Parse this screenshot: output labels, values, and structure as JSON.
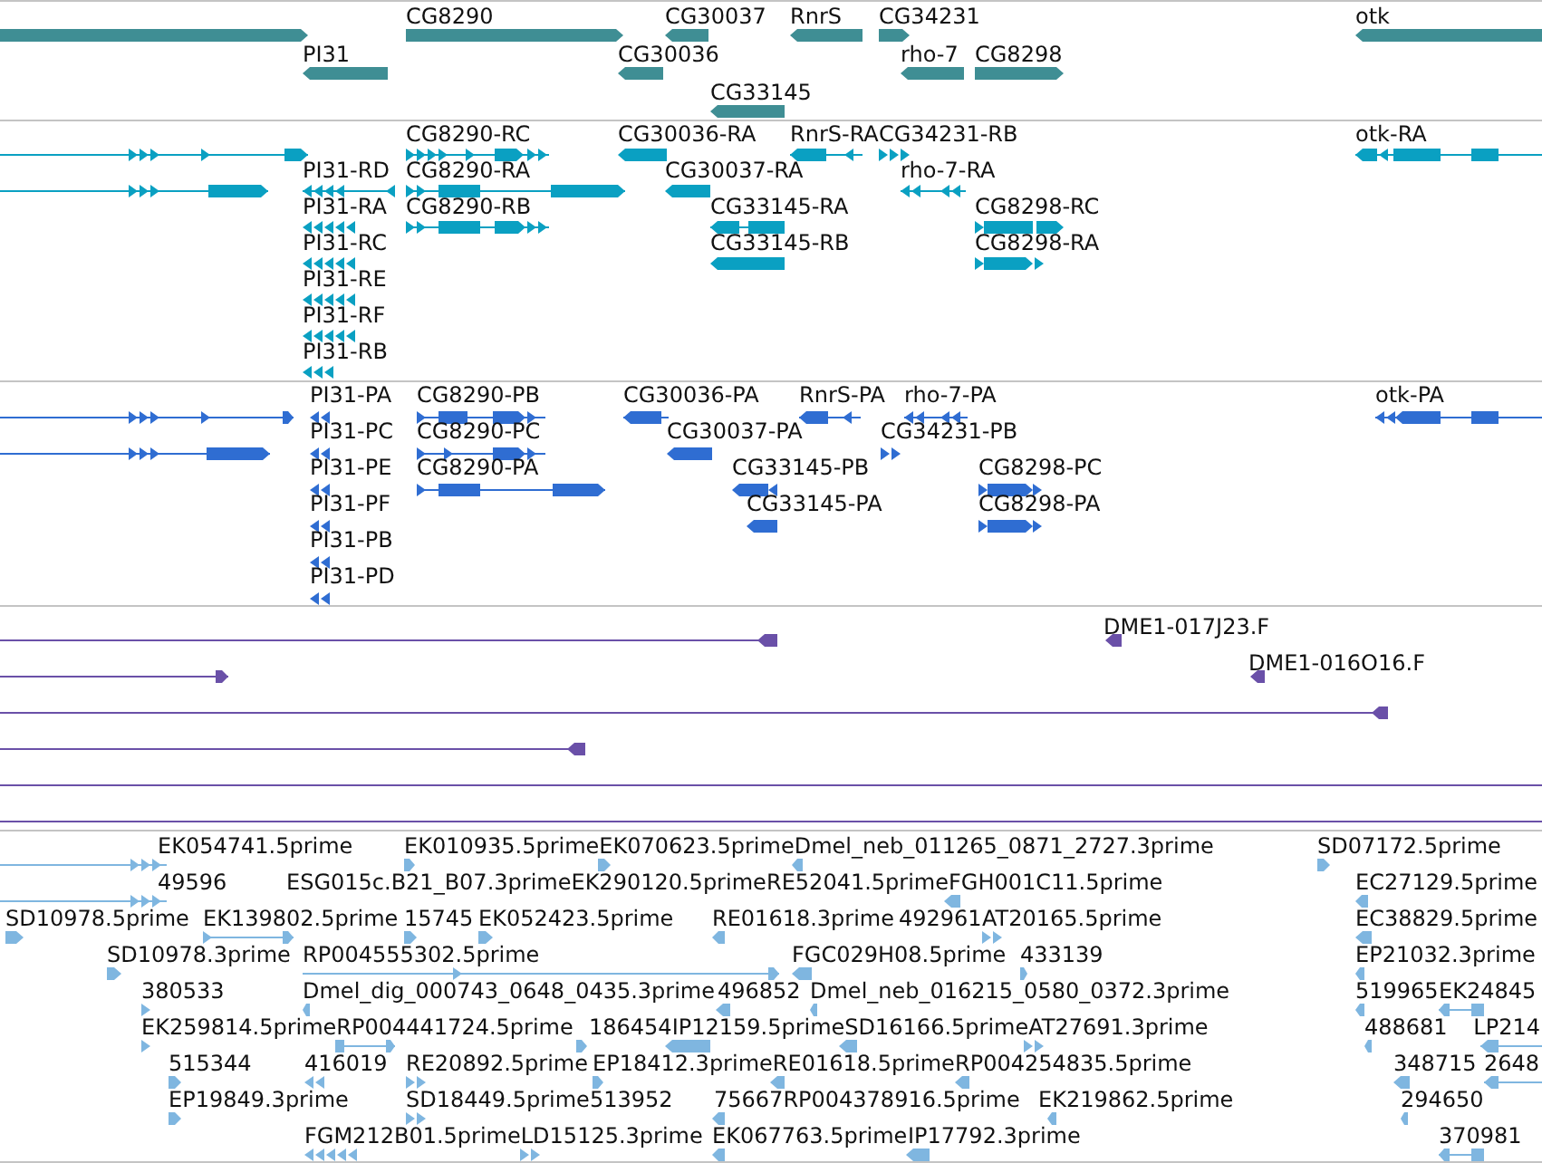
{
  "tracks": [
    {
      "kind": "gene",
      "features": [
        {
          "reverse": false,
          "selected": false
        },
        {
          "label": "CG8290",
          "reverse": false,
          "selected": false
        },
        {
          "label": "CG30037",
          "reverse": true,
          "selected": false
        },
        {
          "label": "RnrS",
          "reverse": true,
          "selected": false
        },
        {
          "label": "CG34231",
          "reverse": false,
          "selected": false
        },
        {
          "label": "otk",
          "reverse": true,
          "selected": false
        },
        {
          "label": "PI31",
          "reverse": true,
          "selected": false
        },
        {
          "label": "CG30036",
          "reverse": true,
          "selected": false
        },
        {
          "label": "rho-7",
          "reverse": true,
          "selected": false
        },
        {
          "label": "CG8298",
          "reverse": false,
          "selected": false
        },
        {
          "label": "CG33145",
          "reverse": true,
          "selected": false
        }
      ]
    },
    {
      "kind": "transcript",
      "features": [
        {
          "reverse": false,
          "selected": false
        },
        {
          "label": "CG8290-RC",
          "reverse": false,
          "selected": false
        },
        {
          "label": "CG30036-RA",
          "reverse": true,
          "selected": false
        },
        {
          "label": "RnrS-RA",
          "reverse": true,
          "selected": false
        },
        {
          "label": "CG34231-RB",
          "reverse": false,
          "selected": false
        },
        {
          "label": "otk-RA",
          "reverse": true,
          "selected": false
        },
        {
          "reverse": false,
          "selected": false
        },
        {
          "label": "PI31-RD",
          "reverse": true,
          "selected": false
        },
        {
          "label": "CG8290-RA",
          "reverse": false,
          "selected": false
        },
        {
          "label": "CG30037-RA",
          "reverse": true,
          "selected": false
        },
        {
          "label": "rho-7-RA",
          "reverse": true,
          "selected": false
        },
        {
          "label": "PI31-RA",
          "reverse": true,
          "selected": false
        },
        {
          "label": "CG8290-RB",
          "reverse": false,
          "selected": false
        },
        {
          "label": "CG33145-RA",
          "reverse": true,
          "selected": false
        },
        {
          "label": "CG8298-RC",
          "reverse": false,
          "selected": false
        },
        {
          "label": "PI31-RC",
          "reverse": true,
          "selected": false
        },
        {
          "label": "CG33145-RB",
          "reverse": true,
          "selected": false
        },
        {
          "label": "CG8298-RA",
          "reverse": false,
          "selected": false
        },
        {
          "label": "PI31-RE",
          "reverse": true,
          "selected": false
        },
        {
          "label": "PI31-RF",
          "reverse": true,
          "selected": false
        },
        {
          "label": "PI31-RB",
          "reverse": true,
          "selected": false
        }
      ]
    },
    {
      "kind": "protein",
      "features": [
        {
          "reverse": false,
          "selected": false
        },
        {
          "label": "PI31-PA",
          "reverse": true,
          "selected": false
        },
        {
          "label": "CG8290-PB",
          "reverse": false,
          "selected": false
        },
        {
          "label": "CG30036-PA",
          "reverse": true,
          "selected": false
        },
        {
          "label": "RnrS-PA",
          "reverse": true,
          "selected": false
        },
        {
          "label": "rho-7-PA",
          "reverse": true,
          "selected": false
        },
        {
          "label": "otk-PA",
          "reverse": true,
          "selected": false
        },
        {
          "reverse": false,
          "selected": false
        },
        {
          "label": "PI31-PC",
          "reverse": true,
          "selected": false
        },
        {
          "label": "CG8290-PC",
          "reverse": false,
          "selected": false
        },
        {
          "label": "CG30037-PA",
          "reverse": true,
          "selected": false
        },
        {
          "label": "CG34231-PB",
          "reverse": false,
          "selected": false
        },
        {
          "label": "PI31-PE",
          "reverse": true,
          "selected": false
        },
        {
          "label": "CG8290-PA",
          "reverse": false,
          "selected": false
        },
        {
          "label": "CG33145-PB",
          "reverse": true,
          "selected": false
        },
        {
          "label": "CG8298-PC",
          "reverse": false,
          "selected": false
        },
        {
          "label": "PI31-PF",
          "reverse": true,
          "selected": false
        },
        {
          "label": "CG33145-PA",
          "reverse": true,
          "selected": false
        },
        {
          "label": "CG8298-PA",
          "reverse": false,
          "selected": false
        },
        {
          "label": "PI31-PB",
          "reverse": true,
          "selected": false
        },
        {
          "label": "PI31-PD",
          "reverse": true,
          "selected": false
        }
      ]
    },
    {
      "kind": "clone",
      "features": [
        {
          "reverse": true,
          "selected": false
        },
        {
          "label": "DME1-017J23.F",
          "reverse": true,
          "selected": false
        },
        {
          "reverse": false,
          "selected": false
        },
        {
          "label": "DME1-016O16.F",
          "reverse": true,
          "selected": false
        },
        {
          "reverse": true,
          "selected": false
        },
        {
          "reverse": true,
          "selected": false
        },
        {
          "selected": false
        },
        {
          "selected": false
        }
      ]
    },
    {
      "kind": "est",
      "features": [
        {
          "label": "EK054741.5prime",
          "reverse": false,
          "selected": false
        },
        {
          "label": "EK010935.5prime",
          "reverse": false,
          "selected": false
        },
        {
          "label": "EK070623.5prime",
          "reverse": false,
          "selected": false
        },
        {
          "label": "Dmel_neb_011265_0871_2727.3prime",
          "reverse": true,
          "selected": false
        },
        {
          "label": "SD07172.5prime",
          "reverse": false,
          "selected": false
        },
        {
          "label": "49596",
          "reverse": false,
          "selected": false
        },
        {
          "label": "ESG015c.B21_B07.3prime",
          "selected": false
        },
        {
          "label": "EK290120.5prime",
          "selected": false
        },
        {
          "label": "RE52041.5prime",
          "selected": false
        },
        {
          "label": "FGH001C11.5prime",
          "reverse": true,
          "selected": false
        },
        {
          "label": "EC27129.5prime",
          "reverse": true,
          "selected": false
        },
        {
          "label": "SD10978.5prime",
          "reverse": false,
          "selected": false
        },
        {
          "label": "EK139802.5prime",
          "reverse": false,
          "selected": false
        },
        {
          "label": "15745",
          "reverse": false,
          "selected": false
        },
        {
          "label": "EK052423.5prime",
          "reverse": false,
          "selected": false
        },
        {
          "label": "RE01618.3prime",
          "reverse": true,
          "selected": false
        },
        {
          "label": "492961",
          "selected": false
        },
        {
          "label": "AT20165.5prime",
          "reverse": false,
          "selected": false
        },
        {
          "label": "EC38829.5prime",
          "reverse": true,
          "selected": false
        },
        {
          "label": "SD10978.3prime",
          "reverse": false,
          "selected": false
        },
        {
          "label": "RP004555302.5prime",
          "reverse": false,
          "selected": false
        },
        {
          "label": "FGC029H08.5prime",
          "reverse": true,
          "selected": false
        },
        {
          "label": "433139",
          "reverse": false,
          "selected": false
        },
        {
          "label": "EP21032.3prime",
          "reverse": true,
          "selected": false
        },
        {
          "label": "380533",
          "reverse": false,
          "selected": false
        },
        {
          "label": "Dmel_dig_000743_0648_0435.3prime",
          "reverse": true,
          "selected": false
        },
        {
          "label": "496852",
          "reverse": true,
          "selected": false
        },
        {
          "label": "Dmel_neb_016215_0580_0372.3prime",
          "reverse": true,
          "selected": false
        },
        {
          "label": "519965",
          "reverse": true,
          "selected": false
        },
        {
          "label": "EK24845",
          "reverse": true,
          "selected": false
        },
        {
          "label": "EK259814.5prime",
          "reverse": false,
          "selected": false
        },
        {
          "label": "RP004441724.5prime",
          "reverse": false,
          "selected": false
        },
        {
          "label": "186454",
          "reverse": false,
          "selected": false
        },
        {
          "label": "IP12159.5prime",
          "reverse": true,
          "selected": false
        },
        {
          "label": "SD16166.5prime",
          "reverse": true,
          "selected": false
        },
        {
          "label": "AT27691.3prime",
          "reverse": false,
          "selected": false
        },
        {
          "label": "488681",
          "reverse": true,
          "selected": false
        },
        {
          "label": "LP214",
          "reverse": true,
          "selected": false
        },
        {
          "label": "515344",
          "reverse": false,
          "selected": false
        },
        {
          "label": "416019",
          "reverse": true,
          "selected": false
        },
        {
          "label": "RE20892.5prime",
          "reverse": false,
          "selected": false
        },
        {
          "label": "EP18412.3prime",
          "reverse": false,
          "selected": false
        },
        {
          "label": "RE01618.5prime",
          "reverse": true,
          "selected": false
        },
        {
          "label": "RP004254835.5prime",
          "reverse": true,
          "selected": false
        },
        {
          "label": "348715",
          "reverse": true,
          "selected": false
        },
        {
          "label": "2648",
          "reverse": true,
          "selected": false
        },
        {
          "label": "EP19849.3prime",
          "reverse": false,
          "selected": false
        },
        {
          "label": "SD18449.5prime",
          "reverse": false,
          "selected": false
        },
        {
          "label": "513952",
          "selected": false
        },
        {
          "label": "75667",
          "reverse": true,
          "selected": false
        },
        {
          "label": "RP004378916.5prime",
          "selected": false
        },
        {
          "label": "EK219862.5prime",
          "reverse": true,
          "selected": false
        },
        {
          "label": "294650",
          "reverse": true,
          "selected": false
        },
        {
          "label": "FGM212B01.5prime",
          "reverse": true,
          "selected": false
        },
        {
          "label": "LD15125.3prime",
          "reverse": false,
          "selected": false
        },
        {
          "label": "EK067763.5prime",
          "reverse": true,
          "selected": false
        },
        {
          "label": "IP17792.3prime",
          "reverse": true,
          "selected": false
        },
        {
          "label": "370981",
          "reverse": true,
          "selected": false
        }
      ]
    }
  ]
}
